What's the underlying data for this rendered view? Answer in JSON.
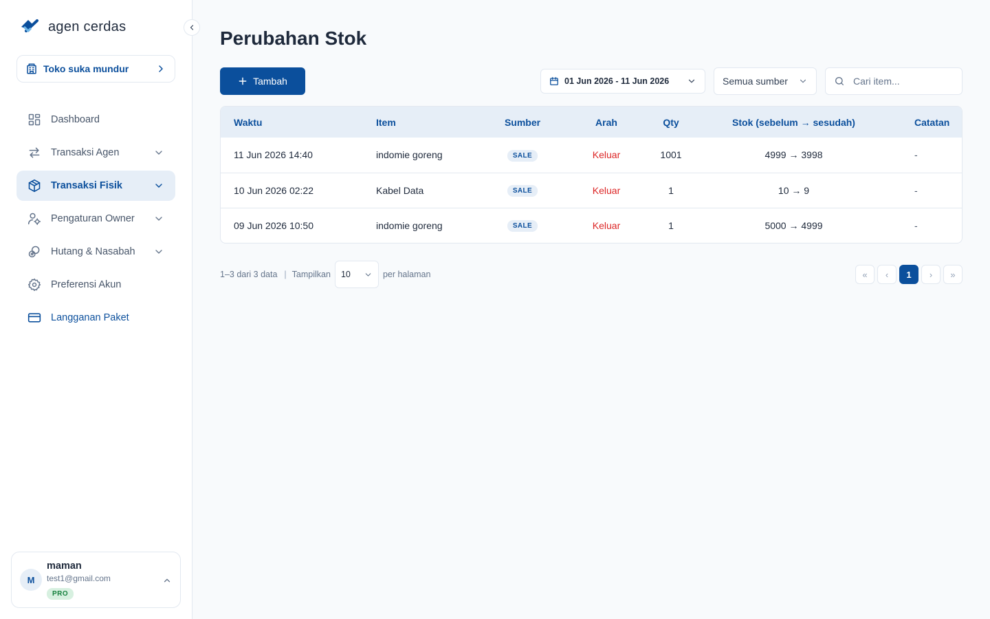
{
  "brand": {
    "name": "agen cerdas"
  },
  "store": {
    "name": "Toko suka mundur"
  },
  "nav": [
    {
      "label": "Dashboard",
      "icon": "grid-icon",
      "state": "normal",
      "expandable": false
    },
    {
      "label": "Transaksi Agen",
      "icon": "transfer-icon",
      "state": "normal",
      "expandable": true
    },
    {
      "label": "Transaksi Fisik",
      "icon": "box-icon",
      "state": "active",
      "expandable": true
    },
    {
      "label": "Pengaturan Owner",
      "icon": "user-settings-icon",
      "state": "normal",
      "expandable": true
    },
    {
      "label": "Hutang & Nasabah",
      "icon": "coins-icon",
      "state": "normal",
      "expandable": true
    },
    {
      "label": "Preferensi Akun",
      "icon": "gear-icon",
      "state": "normal",
      "expandable": false
    },
    {
      "label": "Langganan Paket",
      "icon": "card-icon",
      "state": "link",
      "expandable": false
    }
  ],
  "user": {
    "initial": "M",
    "name": "maman",
    "email": "test1@gmail.com",
    "plan": "PRO"
  },
  "page": {
    "title": "Perubahan Stok"
  },
  "toolbar": {
    "add_label": "Tambah",
    "date_range": "01 Jun 2026 - 11 Jun 2026",
    "source_value": "Semua sumber",
    "search_placeholder": "Cari item..."
  },
  "table": {
    "headers": {
      "waktu": "Waktu",
      "item": "Item",
      "sumber": "Sumber",
      "arah": "Arah",
      "qty": "Qty",
      "stok": "Stok (sebelum → sesudah)",
      "catatan": "Catatan"
    },
    "rows": [
      {
        "waktu": "11 Jun 2026 14:40",
        "item": "indomie goreng",
        "sumber": "SALE",
        "arah": "Keluar",
        "qty": "1001",
        "stok": "4999 → 3998",
        "catatan": "-"
      },
      {
        "waktu": "10 Jun 2026 02:22",
        "item": "Kabel Data",
        "sumber": "SALE",
        "arah": "Keluar",
        "qty": "1",
        "stok": "10 → 9",
        "catatan": "-"
      },
      {
        "waktu": "09 Jun 2026 10:50",
        "item": "indomie goreng",
        "sumber": "SALE",
        "arah": "Keluar",
        "qty": "1",
        "stok": "5000 → 4999",
        "catatan": "-"
      }
    ]
  },
  "pagination": {
    "range_text": "1–3 dari 3 data",
    "show_label": "Tampilkan",
    "per_page": "10",
    "per_page_suffix": "per halaman",
    "first": "«",
    "prev": "‹",
    "current": "1",
    "next": "›",
    "last": "»"
  },
  "colors": {
    "primary": "#0b4f9c",
    "danger": "#dc2626",
    "header_bg": "#e6eef7",
    "pro_badge": "#d7f0e0"
  }
}
